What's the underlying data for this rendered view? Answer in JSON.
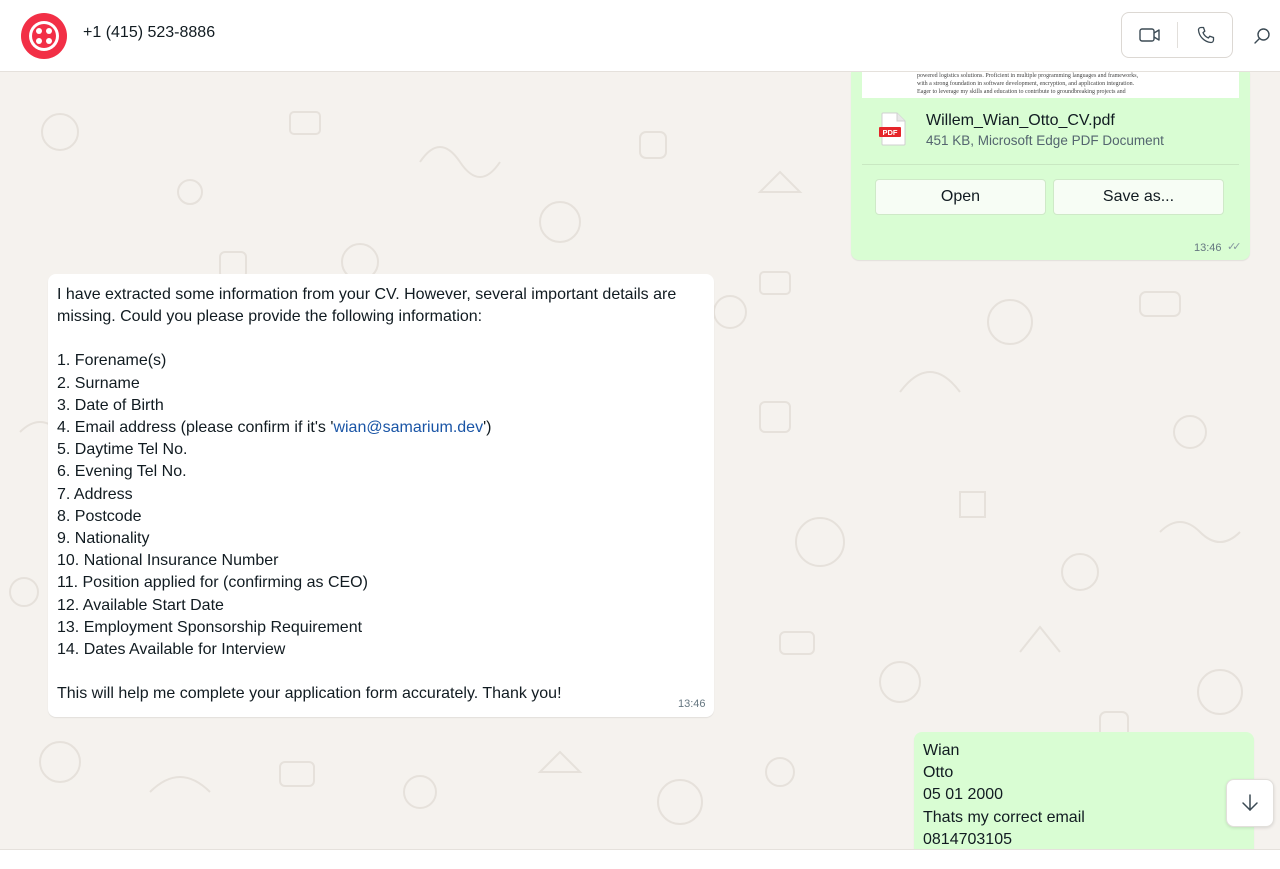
{
  "header": {
    "contact": "+1 (415) 523-8886",
    "avatar_color": "#f22f46",
    "video_icon": "video-camera-icon",
    "phone_icon": "phone-icon",
    "search_icon": "search-icon"
  },
  "file_message": {
    "preview_lines": [
      "powered logistics solutions. Proficient in multiple programming languages and frameworks,",
      "with a strong foundation in software development, encryption, and application integration.",
      "Eager to leverage my skills and education to contribute to groundbreaking projects and"
    ],
    "file_name": "Willem_Wian_Otto_CV.pdf",
    "file_meta": "451 KB, Microsoft Edge PDF Document",
    "pdf_label": "PDF",
    "open_label": "Open",
    "save_label": "Save as...",
    "time": "13:46",
    "status": "read"
  },
  "incoming_message": {
    "intro": "I have extracted some information from your CV. However, several important details are missing. Could you please provide the following information:",
    "items": [
      "1. Forename(s)",
      "2. Surname",
      "3. Date of Birth",
      "5. Daytime Tel No.",
      "6. Evening Tel No.",
      "7. Address",
      "8. Postcode",
      "9. Nationality",
      "10. National Insurance Number",
      "11. Position applied for (confirming as CEO)",
      "12. Available Start Date",
      "13. Employment Sponsorship Requirement",
      "14. Dates Available for Interview"
    ],
    "email_item_prefix": "4. Email address (please confirm if it's '",
    "email_link": "wian@samarium.dev",
    "email_item_suffix": "')",
    "closing": "This will help me complete your application form accurately. Thank you!",
    "time": "13:46"
  },
  "outgoing_message": {
    "lines": [
      "Wian",
      "Otto",
      "05 01 2000",
      "Thats my correct email",
      "0814703105"
    ]
  },
  "scroll_down_icon": "arrow-down-icon"
}
